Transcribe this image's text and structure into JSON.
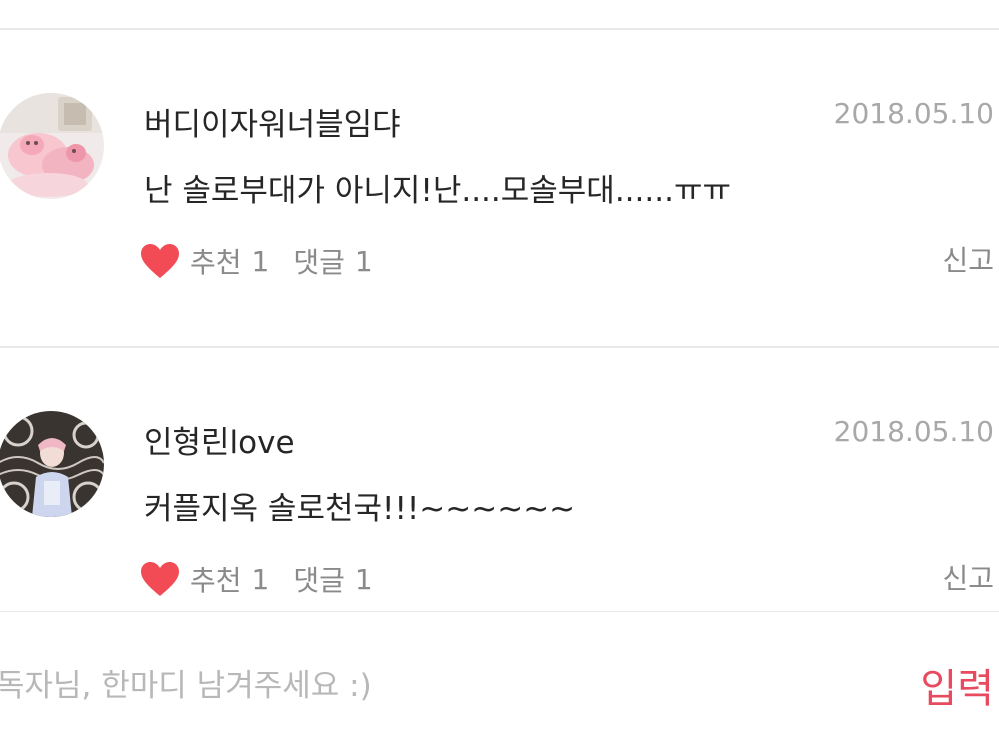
{
  "comments": [
    {
      "username": "버디이자워너블임댜",
      "date": "2018.05.10",
      "text": "난 솔로부대가 아니지!난....모솔부대......ㅠㅠ",
      "like_label": "추천",
      "like_count": "1",
      "reply_label": "댓글",
      "reply_count": "1",
      "report_label": "신고"
    },
    {
      "username": "인형린love",
      "date": "2018.05.10",
      "text": "커플지옥 솔로천국!!!~~~~~~",
      "like_label": "추천",
      "like_count": "1",
      "reply_label": "댓글",
      "reply_count": "1",
      "report_label": "신고"
    }
  ],
  "input_bar": {
    "placeholder": "독자님, 한마디 남겨주세요 :)",
    "submit_label": "입력"
  },
  "colors": {
    "accent": "#e84a5f",
    "heart": "#f24b55",
    "muted": "#8a8a8a",
    "date": "#a8a8a8",
    "divider": "#e8e8e8"
  },
  "icons": {
    "like": "heart-icon"
  }
}
